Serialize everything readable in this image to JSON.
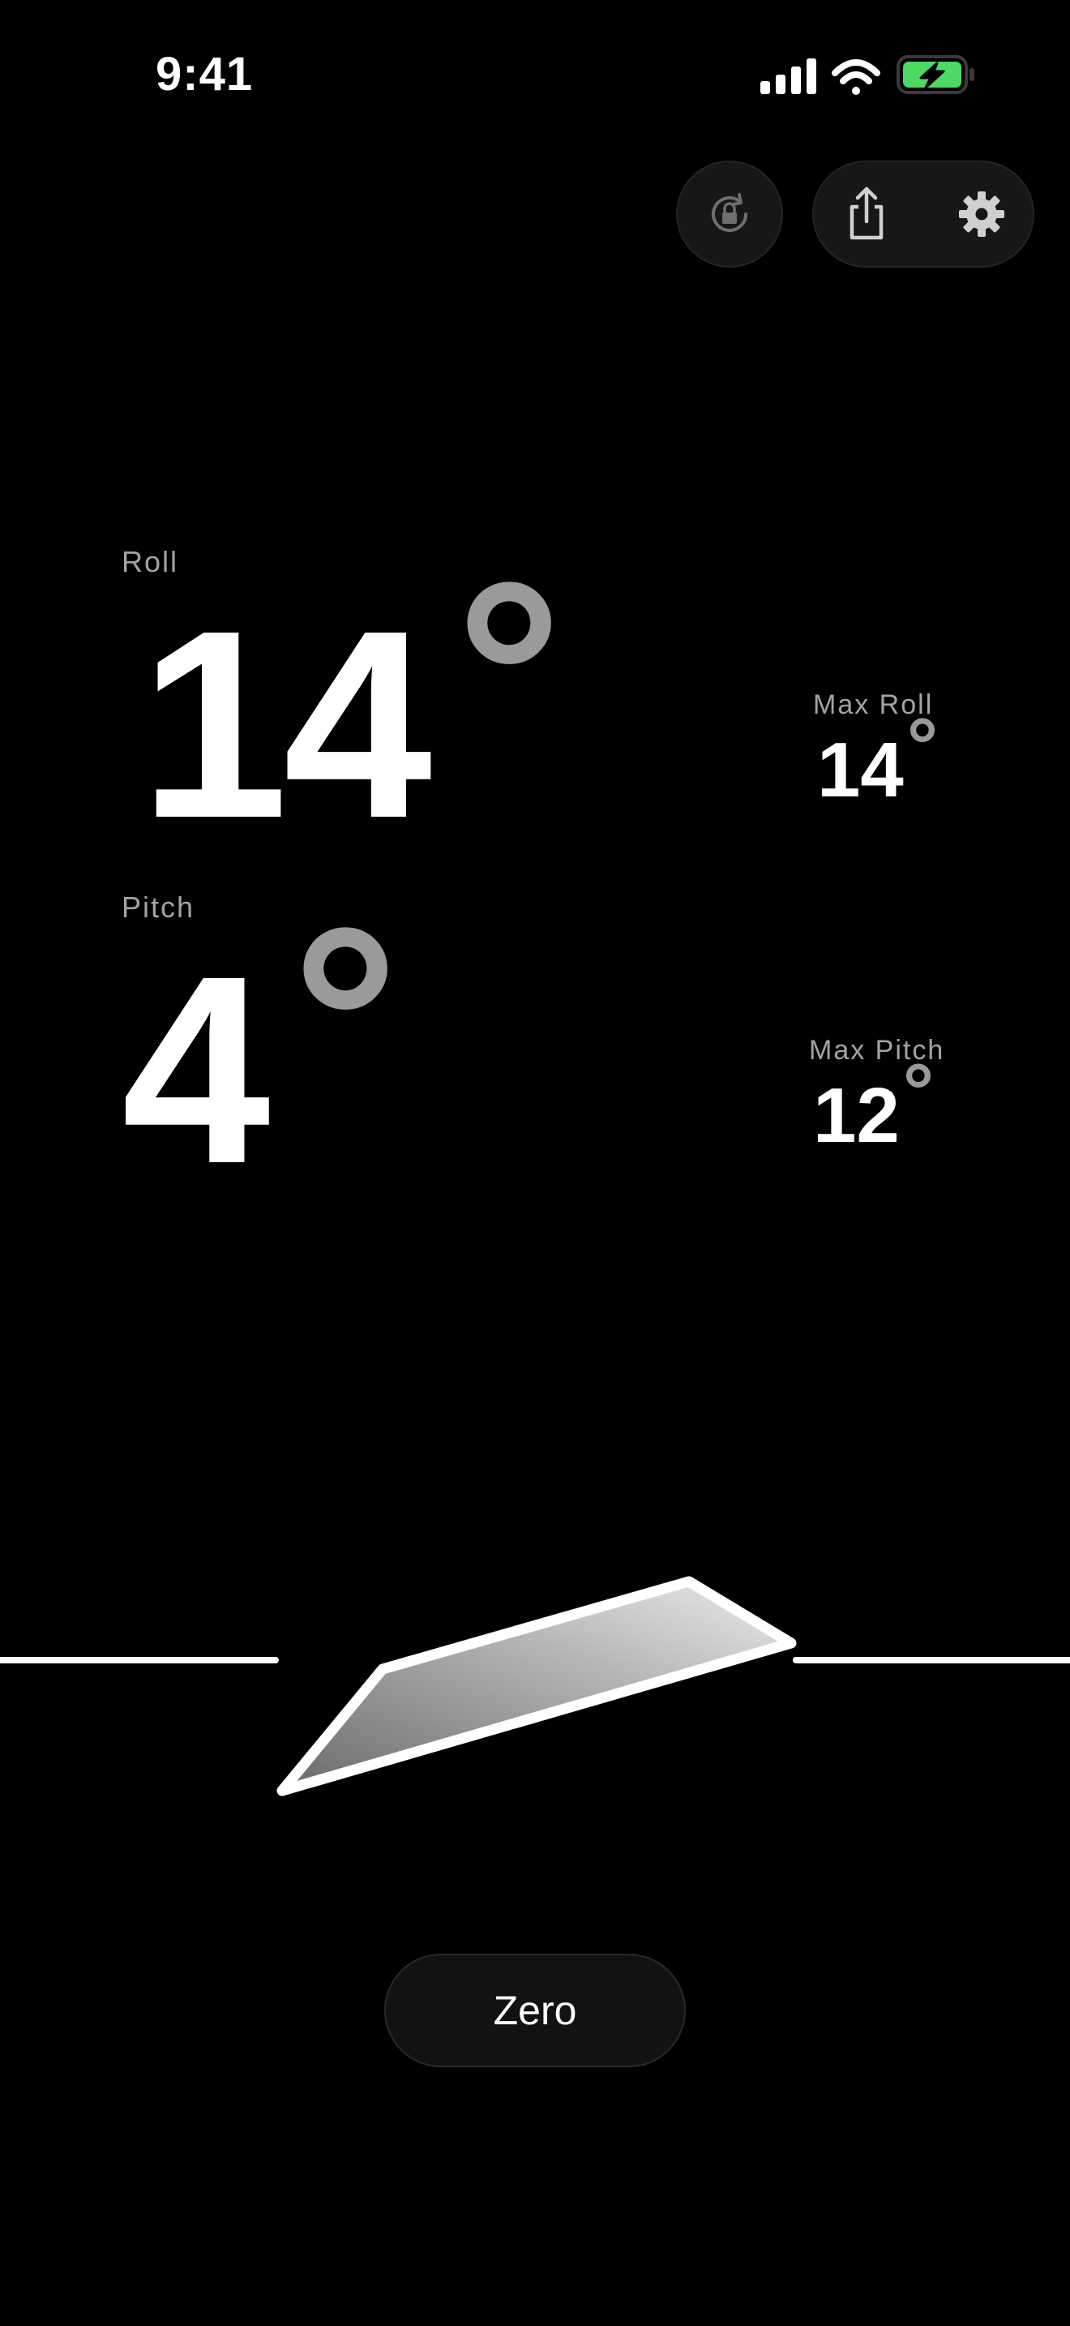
{
  "status_bar": {
    "time": "9:41",
    "icons": [
      "cellular-signal-icon",
      "wifi-icon",
      "battery-charging-icon"
    ],
    "battery_color": "#4cd964"
  },
  "toolbar": {
    "orientation_lock_icon": "orientation-lock-icon",
    "share_icon": "share-icon",
    "settings_icon": "gear-icon"
  },
  "readouts": {
    "roll": {
      "label": "Roll",
      "value": "14",
      "unit": "°"
    },
    "pitch": {
      "label": "Pitch",
      "value": "4",
      "unit": "°"
    },
    "max_roll": {
      "label": "Max Roll",
      "value": "14",
      "unit": "°"
    },
    "max_pitch": {
      "label": "Max Pitch",
      "value": "12",
      "unit": "°"
    }
  },
  "zero_button": {
    "label": "Zero"
  },
  "colors": {
    "background": "#000000",
    "primary_text": "#ffffff",
    "secondary_text": "#a3a3a3",
    "degree_symbol": "#9a9a9a"
  }
}
